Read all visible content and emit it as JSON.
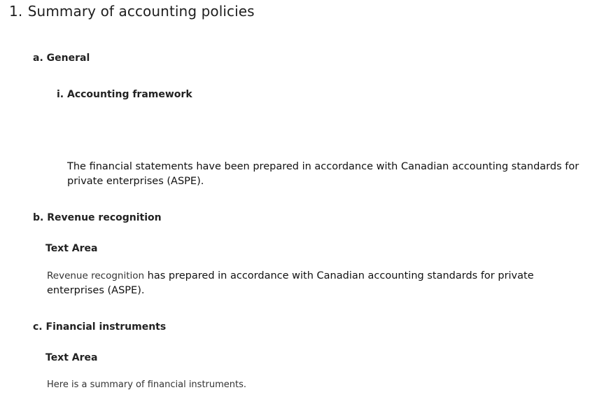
{
  "section": {
    "number": "1.",
    "title": "Summary of accounting policies"
  },
  "subsections": {
    "a": {
      "letter": "a.",
      "title": "General",
      "item_i": {
        "numeral": "i.",
        "title": "Accounting framework",
        "text": "The financial statements have been prepared in accordance with Canadian accounting standards for private enterprises (ASPE)."
      }
    },
    "b": {
      "letter": "b.",
      "title": "Revenue recognition",
      "area_label": "Text Area",
      "text_lead": "Revenue recognition",
      "text_rest": " has prepared in accordance with Canadian accounting standards for private enterprises (ASPE)."
    },
    "c": {
      "letter": "c.",
      "title": "Financial instruments",
      "area_label": "Text Area",
      "text": "Here is a summary of financial instruments."
    }
  }
}
